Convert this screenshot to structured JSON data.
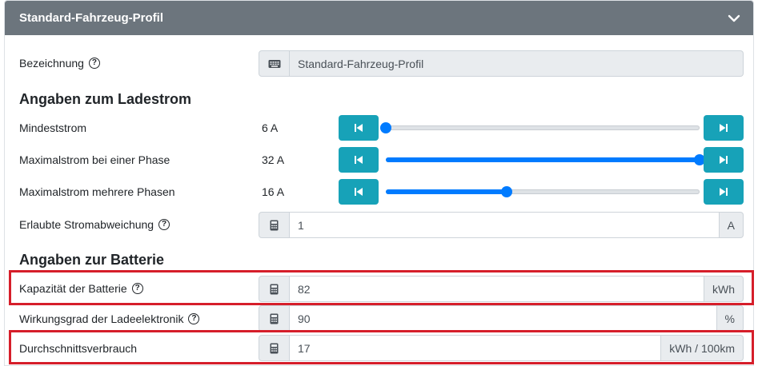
{
  "header": {
    "title": "Standard-Fahrzeug-Profil",
    "toggle_icon": "chevron-down-icon"
  },
  "bezeichnung": {
    "label": "Bezeichnung",
    "value": "Standard-Fahrzeug-Profil",
    "icon": "keyboard-icon"
  },
  "ladestrom": {
    "title": "Angaben zum Ladestrom",
    "mindeststrom": {
      "label": "Mindeststrom",
      "value": "6 A",
      "level": 0.0
    },
    "max_eine_phase": {
      "label": "Maximalstrom bei einer Phase",
      "value": "32 A",
      "level": 1.0
    },
    "max_mehrere_phasen": {
      "label": "Maximalstrom mehrere Phasen",
      "value": "16 A",
      "level": 0.385
    },
    "abweichung": {
      "label": "Erlaubte Stromabweichung",
      "value": "1",
      "unit": "A",
      "icon": "calculator-icon"
    }
  },
  "batterie": {
    "title": "Angaben zur Batterie",
    "kapazitaet": {
      "label": "Kapazität der Batterie",
      "value": "82",
      "unit": "kWh"
    },
    "wirkungsgrad": {
      "label": "Wirkungsgrad der Ladeelektronik",
      "value": "90",
      "unit": "%"
    },
    "verbrauch": {
      "label": "Durchschnittsverbrauch",
      "value": "17",
      "unit": "kWh / 100km"
    }
  },
  "colors": {
    "header_bg": "#6c757d",
    "button": "#17a2b8",
    "slider": "#007bff",
    "highlight": "#d61e2a"
  }
}
